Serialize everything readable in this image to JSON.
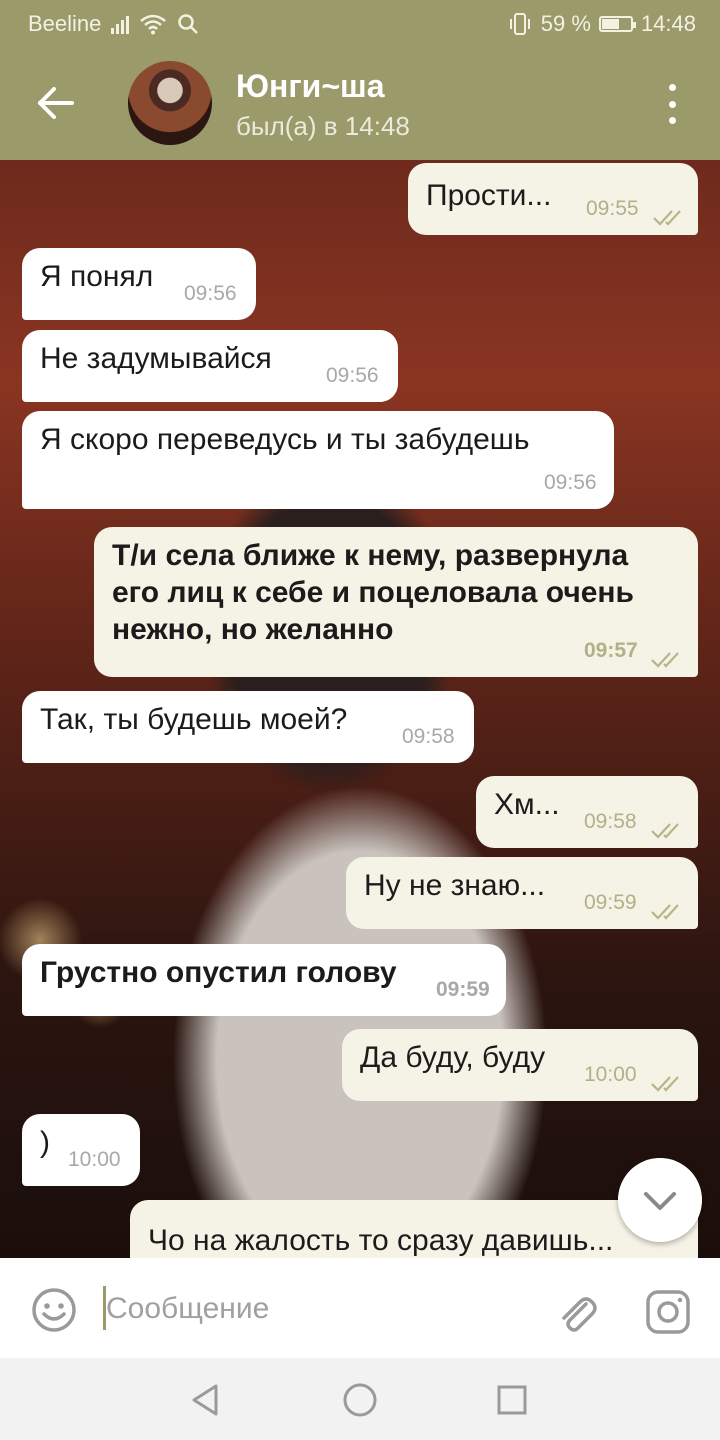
{
  "status_bar": {
    "carrier": "Beeline",
    "battery_text": "59 %",
    "battery_level": 0.59,
    "time": "14:48"
  },
  "header": {
    "name": "Юнги~ша",
    "status": "был(а) в 14:48"
  },
  "messages": [
    {
      "dir": "out",
      "text": "Прости...",
      "time": "09:55",
      "bold": false,
      "read": true
    },
    {
      "dir": "in",
      "text": "Я понял",
      "time": "09:56",
      "bold": false
    },
    {
      "dir": "in",
      "text": "Не задумывайся",
      "time": "09:56",
      "bold": false
    },
    {
      "dir": "in",
      "text": "Я скоро переведусь и ты забудешь",
      "time": "09:56",
      "bold": false
    },
    {
      "dir": "out",
      "text": "Т/и села ближе к нему, развернула его лиц к себе и поцеловала очень нежно, но желанно",
      "time": "09:57",
      "bold": true,
      "read": true
    },
    {
      "dir": "in",
      "text": "Так, ты будешь моей?",
      "time": "09:58",
      "bold": false
    },
    {
      "dir": "out",
      "text": "Хм...",
      "time": "09:58",
      "bold": false,
      "read": true
    },
    {
      "dir": "out",
      "text": "Ну не знаю...",
      "time": "09:59",
      "bold": false,
      "read": true
    },
    {
      "dir": "in",
      "text": "Грустно опустил голову",
      "time": "09:59",
      "bold": true
    },
    {
      "dir": "out",
      "text": "Да буду, буду",
      "time": "10:00",
      "bold": false,
      "read": true
    },
    {
      "dir": "in",
      "text": ")",
      "time": "10:00",
      "bold": false
    },
    {
      "dir": "out",
      "text": "Чо на жалость то сразу давишь...",
      "time": "",
      "bold": false,
      "read": false
    }
  ],
  "input": {
    "placeholder": "Сообщение"
  },
  "colors": {
    "accent": "#9a9a6a",
    "incoming": "#ffffff",
    "outgoing": "#f5f3e6",
    "time_text": "#a8a8a8"
  },
  "icons": [
    "back-arrow-icon",
    "more-vert-icon",
    "check-double-icon",
    "chevron-down-icon",
    "emoji-icon",
    "attach-icon",
    "camera-icon",
    "nav-back-icon",
    "nav-home-icon",
    "nav-recents-icon",
    "signal-icon",
    "wifi-icon",
    "search-icon",
    "vibrate-icon",
    "battery-icon"
  ]
}
